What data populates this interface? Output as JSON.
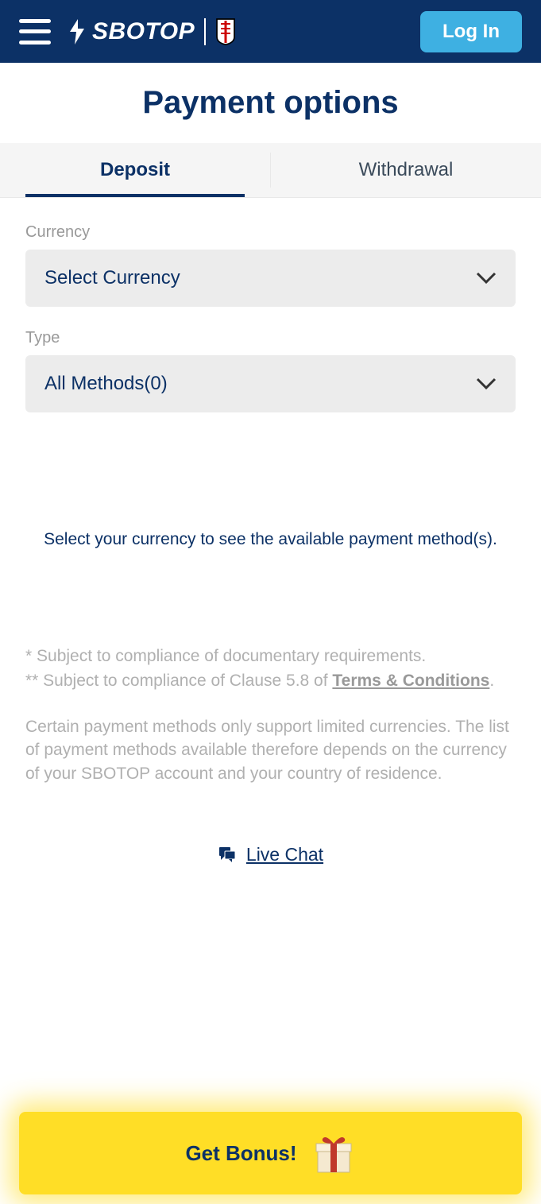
{
  "header": {
    "brand": "SBOTOP",
    "login_label": "Log In"
  },
  "title": "Payment options",
  "tabs": {
    "deposit": "Deposit",
    "withdrawal": "Withdrawal"
  },
  "form": {
    "currency_label": "Currency",
    "currency_value": "Select Currency",
    "type_label": "Type",
    "type_value": "All Methods(0)"
  },
  "info_message": "Select your currency to see the available payment method(s).",
  "disclaimer": {
    "line1": "* Subject to compliance of documentary requirements.",
    "line2_prefix": "** Subject to compliance of Clause 5.8 of ",
    "terms_link": "Terms & Conditions",
    "line2_suffix": ".",
    "note": "Certain payment methods only support limited currencies. The list of payment methods available therefore depends on the currency of your SBOTOP account and your country of residence."
  },
  "live_chat": "Live Chat",
  "bonus": {
    "label": "Get Bonus!"
  }
}
